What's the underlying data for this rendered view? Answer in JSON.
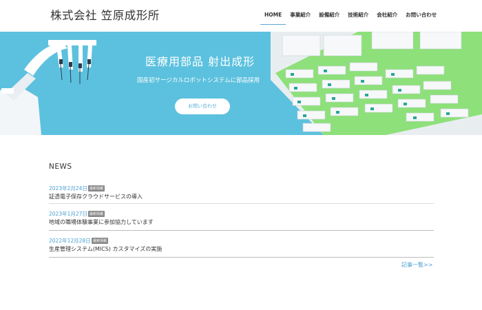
{
  "header": {
    "logo": "株式会社 笠原成形所",
    "nav": [
      {
        "label": "HOME",
        "active": true
      },
      {
        "label": "事業紹介"
      },
      {
        "label": "設備紹介"
      },
      {
        "label": "技術紹介"
      },
      {
        "label": "会社紹介"
      },
      {
        "label": "お問い合わせ"
      }
    ]
  },
  "hero": {
    "title": "医療用部品 射出成形",
    "subtitle": "国産初サージカルロボットシステムに部品採用",
    "button": "お問い合わせ",
    "colors": {
      "sky": "#5cc1de",
      "floor": "#8ee07a",
      "wall": "#e8eef0"
    }
  },
  "news": {
    "heading": "NEWS",
    "items": [
      {
        "date": "2023年2月24日",
        "badge": "最新情報",
        "title": "証憑電子保存クラウドサービスの導入"
      },
      {
        "date": "2023年1月27日",
        "badge": "最新情報",
        "title": "地域の職場体験事業に参加協力しています"
      },
      {
        "date": "2022年12月28日",
        "badge": "最新情報",
        "title": "生産管理システム(MICS) カスタマイズの実施"
      }
    ],
    "more": "記事一覧>>"
  }
}
